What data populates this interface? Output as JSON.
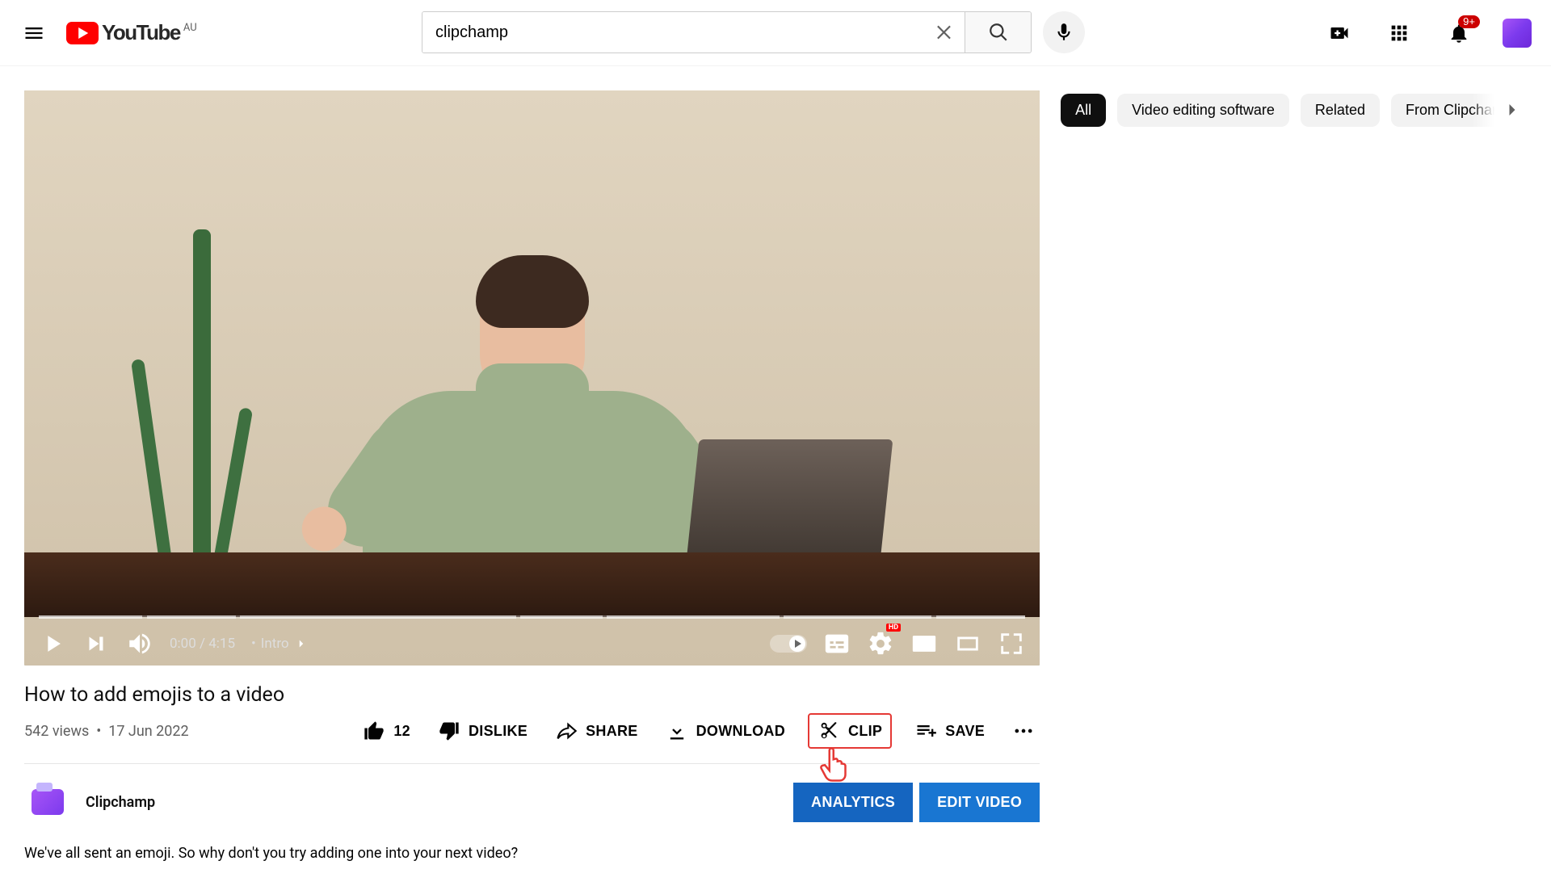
{
  "header": {
    "country": "AU",
    "logo_text": "YouTube",
    "search_value": "clipchamp",
    "notif_badge": "9+"
  },
  "player": {
    "time_current": "0:00",
    "time_total": "4:15",
    "chapter_label": "Intro",
    "hd_badge": "HD",
    "chapter_markers": [
      {
        "left_pct": 0,
        "width_pct": 10.5
      },
      {
        "left_pct": 11,
        "width_pct": 9
      },
      {
        "left_pct": 20.4,
        "width_pct": 28
      },
      {
        "left_pct": 48.8,
        "width_pct": 8.4
      },
      {
        "left_pct": 57.6,
        "width_pct": 17.5
      },
      {
        "left_pct": 75.5,
        "width_pct": 15
      },
      {
        "left_pct": 91,
        "width_pct": 9
      }
    ]
  },
  "video": {
    "title": "How to add emojis to a video",
    "views": "542 views",
    "date": "17 Jun 2022",
    "like_count": "12",
    "dislike_label": "DISLIKE",
    "share_label": "SHARE",
    "download_label": "DOWNLOAD",
    "clip_label": "CLIP",
    "save_label": "SAVE",
    "channel_name": "Clipchamp",
    "analytics_label": "ANALYTICS",
    "edit_label": "EDIT VIDEO",
    "description": "We've all sent an emoji. So why don't you try adding one into your next video?"
  },
  "sidebar": {
    "chips": [
      {
        "label": "All",
        "active": true
      },
      {
        "label": "Video editing software",
        "active": false
      },
      {
        "label": "Related",
        "active": false
      },
      {
        "label": "From Clipchamp",
        "active": false
      }
    ]
  }
}
